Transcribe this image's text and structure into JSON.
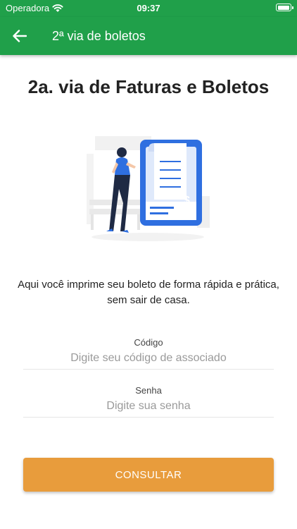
{
  "status_bar": {
    "carrier": "Operadora",
    "time": "09:37"
  },
  "app_bar": {
    "title": "2ª via de boletos"
  },
  "heading": "2a. via de Faturas e Boletos",
  "description": "Aqui você imprime seu boleto de forma rápida e prática, sem sair de casa.",
  "form": {
    "codigo": {
      "label": "Código",
      "placeholder": "Digite seu código de associado",
      "value": ""
    },
    "senha": {
      "label": "Senha",
      "placeholder": "Digite sua senha",
      "value": ""
    }
  },
  "button": {
    "label": "CONSULTAR"
  },
  "colors": {
    "primary": "#20a04a",
    "accent": "#e89c3c",
    "illustration_blue": "#2f6fe0"
  }
}
